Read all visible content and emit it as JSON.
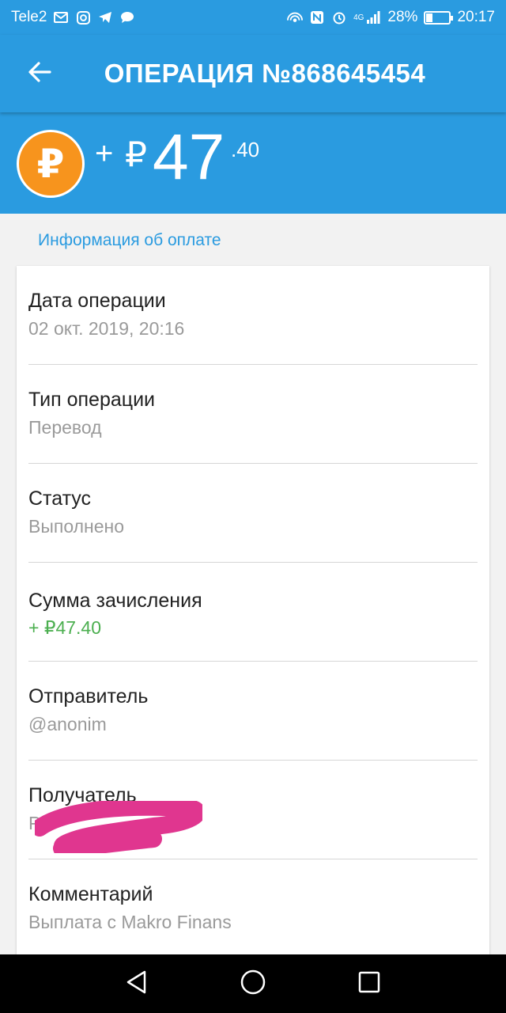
{
  "status_bar": {
    "carrier": "Tele2",
    "network": "4G",
    "battery_percent": "28%",
    "battery_level": 0.28,
    "time": "20:17",
    "icons": [
      "mail-icon",
      "instagram-icon",
      "telegram-icon",
      "chat-icon",
      "hotspot-icon",
      "nfc-icon",
      "alarm-icon",
      "signal-icon",
      "battery-icon"
    ]
  },
  "app_bar": {
    "title": "ОПЕРАЦИЯ №868645454",
    "back_icon": "arrow-left-icon"
  },
  "hero": {
    "sign": "+",
    "currency": "₽",
    "amount_int": "47",
    "amount_frac": ".40",
    "coin_symbol": "₽",
    "coin_color": "#f7941d"
  },
  "section_title": "Информация об оплате",
  "details": [
    {
      "label": "Дата операции",
      "value": "02 окт. 2019, 20:16"
    },
    {
      "label": "Тип операции",
      "value": "Перевод"
    },
    {
      "label": "Статус",
      "value": "Выполнено"
    },
    {
      "label": "Сумма зачисления",
      "value": "+ ₽47.40"
    },
    {
      "label": "Отправитель",
      "value": "@anonim"
    },
    {
      "label": "Получатель",
      "value": "Р"
    },
    {
      "label": "Комментарий",
      "value": "Выплата с Makro Finans"
    }
  ],
  "colors": {
    "primary": "#2a9be0",
    "accent_coin": "#f7941d",
    "positive": "#4caf50",
    "redaction": "#e0368f"
  },
  "nav_bar": {
    "icons": [
      "back-triangle-icon",
      "home-circle-icon",
      "recents-square-icon"
    ]
  }
}
